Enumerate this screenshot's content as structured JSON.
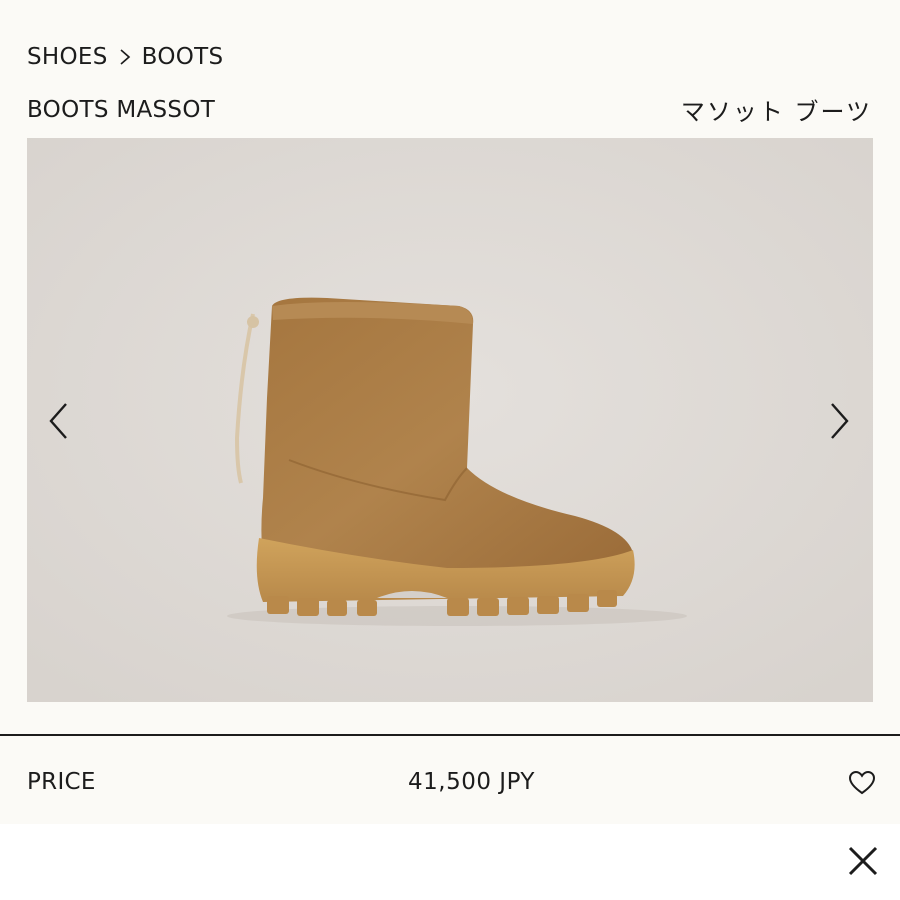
{
  "breadcrumb": {
    "items": [
      "SHOES",
      "BOOTS"
    ]
  },
  "product": {
    "title": "BOOTS MASSOT",
    "title_jp": "マソット ブーツ"
  },
  "gallery": {
    "prev_icon": "chevron-left-icon",
    "next_icon": "chevron-right-icon"
  },
  "price": {
    "label": "PRICE",
    "value": "41,500 JPY"
  },
  "icons": {
    "favorite": "heart-icon",
    "close": "close-icon"
  },
  "colors": {
    "background": "#fbfaf6",
    "text": "#1c1c1c",
    "boot_suede": "#a97d45",
    "boot_sole": "#c79a55"
  }
}
